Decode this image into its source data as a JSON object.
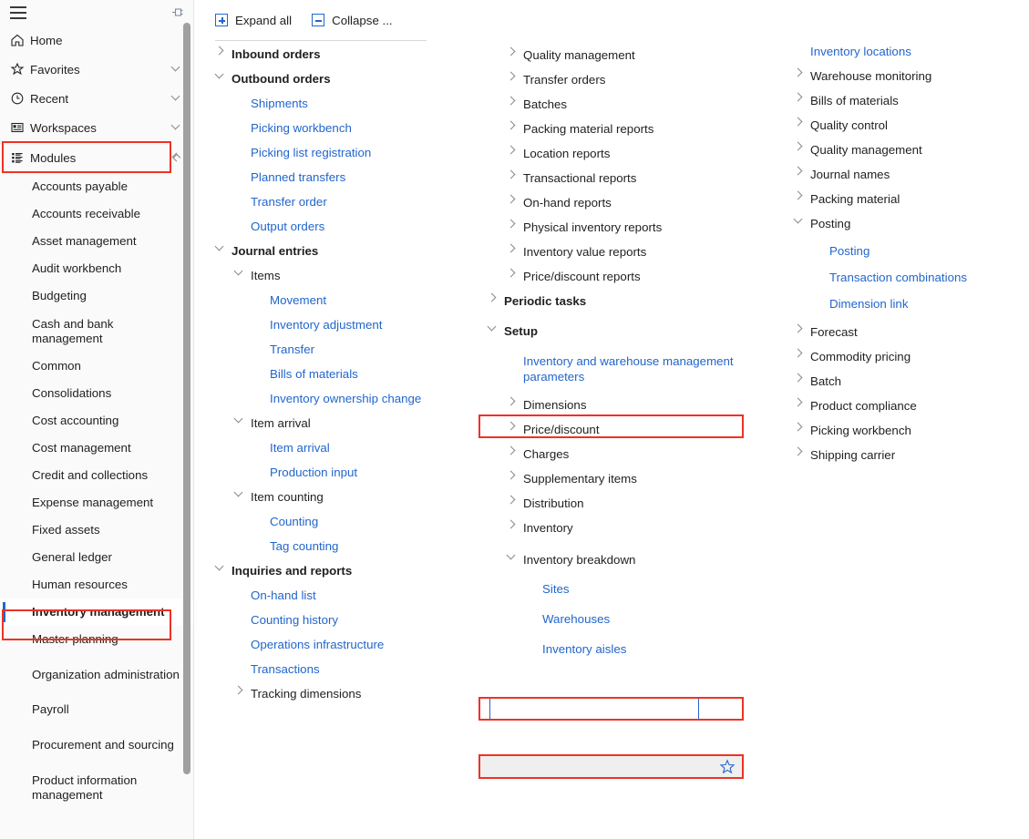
{
  "nav": {
    "menu_icon": "hamburger-icon",
    "pin_icon": "pin-icon",
    "items": [
      {
        "label": "Home",
        "icon": "home-icon",
        "chevron": ""
      },
      {
        "label": "Favorites",
        "icon": "star-icon",
        "chevron": "⌄"
      },
      {
        "label": "Recent",
        "icon": "clock-icon",
        "chevron": "⌄"
      },
      {
        "label": "Workspaces",
        "icon": "workspaces-icon",
        "chevron": "⌄"
      },
      {
        "label": "Modules",
        "icon": "modules-icon",
        "chevron": "⌃"
      }
    ],
    "modules": [
      {
        "label": "Accounts payable",
        "selected": false
      },
      {
        "label": "Accounts receivable",
        "selected": false
      },
      {
        "label": "Asset management",
        "selected": false
      },
      {
        "label": "Audit workbench",
        "selected": false
      },
      {
        "label": "Budgeting",
        "selected": false
      },
      {
        "label": "Cash and bank management",
        "selected": false
      },
      {
        "label": "Common",
        "selected": false
      },
      {
        "label": "Consolidations",
        "selected": false
      },
      {
        "label": "Cost accounting",
        "selected": false
      },
      {
        "label": "Cost management",
        "selected": false
      },
      {
        "label": "Credit and collections",
        "selected": false
      },
      {
        "label": "Expense management",
        "selected": false
      },
      {
        "label": "Fixed assets",
        "selected": false
      },
      {
        "label": "General ledger",
        "selected": false
      },
      {
        "label": "Human resources",
        "selected": false
      },
      {
        "label": "Inventory management",
        "selected": true
      },
      {
        "label": "Master planning",
        "selected": false
      },
      {
        "label": "Organization administration",
        "selected": false
      },
      {
        "label": "Payroll",
        "selected": false
      },
      {
        "label": "Procurement and sourcing",
        "selected": false
      },
      {
        "label": "Product information management",
        "selected": false
      }
    ]
  },
  "toolbar": {
    "expand_all": "Expand all",
    "collapse_all": "Collapse ..."
  },
  "column1": [
    {
      "text": "Inbound orders",
      "type": "group",
      "state": "collapsed",
      "indent": 0
    },
    {
      "text": "Outbound orders",
      "type": "group",
      "state": "expanded",
      "indent": 0
    },
    {
      "text": "Shipments",
      "type": "link",
      "indent": 1
    },
    {
      "text": "Picking workbench",
      "type": "link",
      "indent": 1
    },
    {
      "text": "Picking list registration",
      "type": "link",
      "indent": 1
    },
    {
      "text": "Planned transfers",
      "type": "link",
      "indent": 1
    },
    {
      "text": "Transfer order",
      "type": "link",
      "indent": 1
    },
    {
      "text": "Output orders",
      "type": "link",
      "indent": 1
    },
    {
      "text": "Journal entries",
      "type": "group",
      "state": "expanded",
      "indent": 0
    },
    {
      "text": "Items",
      "type": "sub",
      "state": "expanded",
      "indent": 1
    },
    {
      "text": "Movement",
      "type": "link",
      "indent": 2
    },
    {
      "text": "Inventory adjustment",
      "type": "link",
      "indent": 2
    },
    {
      "text": "Transfer",
      "type": "link",
      "indent": 2
    },
    {
      "text": "Bills of materials",
      "type": "link",
      "indent": 2
    },
    {
      "text": "Inventory ownership change",
      "type": "link",
      "indent": 2
    },
    {
      "text": "Item arrival",
      "type": "sub",
      "state": "expanded",
      "indent": 1
    },
    {
      "text": "Item arrival",
      "type": "link",
      "indent": 2
    },
    {
      "text": "Production input",
      "type": "link",
      "indent": 2
    },
    {
      "text": "Item counting",
      "type": "sub",
      "state": "expanded",
      "indent": 1
    },
    {
      "text": "Counting",
      "type": "link",
      "indent": 2
    },
    {
      "text": "Tag counting",
      "type": "link",
      "indent": 2
    },
    {
      "text": "Inquiries and reports",
      "type": "group",
      "state": "expanded",
      "indent": 0
    },
    {
      "text": "On-hand list",
      "type": "link",
      "indent": 1
    },
    {
      "text": "Counting history",
      "type": "link",
      "indent": 1
    },
    {
      "text": "Operations infrastructure",
      "type": "link",
      "indent": 1
    },
    {
      "text": "Transactions",
      "type": "link",
      "indent": 1
    },
    {
      "text": "Tracking dimensions",
      "type": "sub",
      "state": "collapsed",
      "indent": 1
    }
  ],
  "column2": [
    {
      "text": "Quality management",
      "type": "sub",
      "state": "collapsed",
      "indent": 1
    },
    {
      "text": "Transfer orders",
      "type": "sub",
      "state": "collapsed",
      "indent": 1
    },
    {
      "text": "Batches",
      "type": "sub",
      "state": "collapsed",
      "indent": 1
    },
    {
      "text": "Packing material reports",
      "type": "sub",
      "state": "collapsed",
      "indent": 1
    },
    {
      "text": "Location reports",
      "type": "sub",
      "state": "collapsed",
      "indent": 1
    },
    {
      "text": "Transactional reports",
      "type": "sub",
      "state": "collapsed",
      "indent": 1
    },
    {
      "text": "On-hand reports",
      "type": "sub",
      "state": "collapsed",
      "indent": 1
    },
    {
      "text": "Physical inventory reports",
      "type": "sub",
      "state": "collapsed",
      "indent": 1
    },
    {
      "text": "Inventory value reports",
      "type": "sub",
      "state": "collapsed",
      "indent": 1
    },
    {
      "text": "Price/discount reports",
      "type": "sub",
      "state": "collapsed",
      "indent": 1
    },
    {
      "text": "Periodic tasks",
      "type": "group",
      "state": "collapsed",
      "indent": 0
    },
    {
      "text": "Setup",
      "type": "group",
      "state": "expanded",
      "indent": 0,
      "highlight": "setup"
    },
    {
      "text": "Inventory and warehouse management parameters",
      "type": "link",
      "indent": 1
    },
    {
      "text": "Dimensions",
      "type": "sub",
      "state": "collapsed",
      "indent": 1
    },
    {
      "text": "Price/discount",
      "type": "sub",
      "state": "collapsed",
      "indent": 1
    },
    {
      "text": "Charges",
      "type": "sub",
      "state": "collapsed",
      "indent": 1
    },
    {
      "text": "Supplementary items",
      "type": "sub",
      "state": "collapsed",
      "indent": 1
    },
    {
      "text": "Distribution",
      "type": "sub",
      "state": "collapsed",
      "indent": 1
    },
    {
      "text": "Inventory",
      "type": "sub",
      "state": "collapsed",
      "indent": 1
    },
    {
      "text": "Inventory breakdown",
      "type": "sub",
      "state": "expanded",
      "indent": 1,
      "highlight": "breakdown",
      "focused": true
    },
    {
      "text": "Sites",
      "type": "link",
      "indent": 2
    },
    {
      "text": "Warehouses",
      "type": "link",
      "indent": 2,
      "highlight": "warehouses",
      "hovered": true,
      "favorite_icon": "star-outline-icon"
    },
    {
      "text": "Inventory aisles",
      "type": "link",
      "indent": 2
    }
  ],
  "column3": [
    {
      "text": "Inventory locations",
      "type": "link",
      "indent": 1
    },
    {
      "text": "Warehouse monitoring",
      "type": "sub",
      "state": "collapsed",
      "indent": 1
    },
    {
      "text": "Bills of materials",
      "type": "sub",
      "state": "collapsed",
      "indent": 1
    },
    {
      "text": "Quality control",
      "type": "sub",
      "state": "collapsed",
      "indent": 1
    },
    {
      "text": "Quality management",
      "type": "sub",
      "state": "collapsed",
      "indent": 1
    },
    {
      "text": "Journal names",
      "type": "sub",
      "state": "collapsed",
      "indent": 1
    },
    {
      "text": "Packing material",
      "type": "sub",
      "state": "collapsed",
      "indent": 1
    },
    {
      "text": "Posting",
      "type": "sub",
      "state": "expanded",
      "indent": 1
    },
    {
      "text": "Posting",
      "type": "link",
      "indent": 2
    },
    {
      "text": "Transaction combinations",
      "type": "link",
      "indent": 2
    },
    {
      "text": "Dimension link",
      "type": "link",
      "indent": 2
    },
    {
      "text": "Forecast",
      "type": "sub",
      "state": "collapsed",
      "indent": 1
    },
    {
      "text": "Commodity pricing",
      "type": "sub",
      "state": "collapsed",
      "indent": 1
    },
    {
      "text": "Batch",
      "type": "sub",
      "state": "collapsed",
      "indent": 1
    },
    {
      "text": "Product compliance",
      "type": "sub",
      "state": "collapsed",
      "indent": 1
    },
    {
      "text": "Picking workbench",
      "type": "sub",
      "state": "collapsed",
      "indent": 1
    },
    {
      "text": "Shipping carrier",
      "type": "sub",
      "state": "collapsed",
      "indent": 1
    }
  ],
  "colors": {
    "link": "#2266cc",
    "text": "#201f1e",
    "highlight_box": "#ee3224",
    "nav_bg": "#fafafa",
    "hover_row": "#efefef"
  }
}
